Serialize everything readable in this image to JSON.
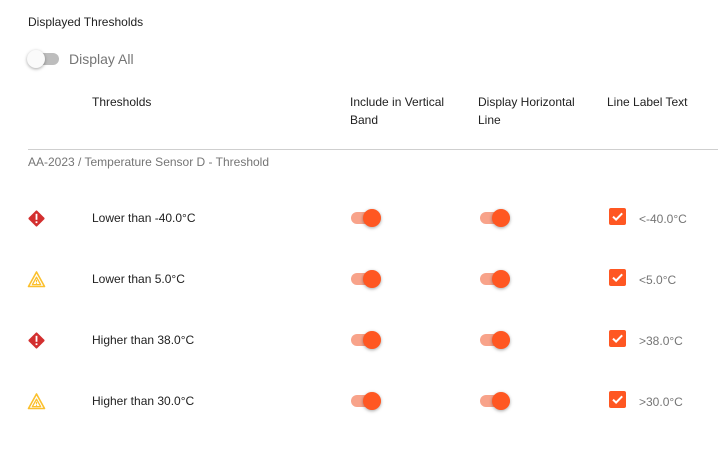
{
  "section_title": "Displayed Thresholds",
  "display_all": {
    "label": "Display All",
    "on": false
  },
  "columns": {
    "thresholds": "Thresholds",
    "vertical_band": "Include in Vertical Band",
    "horizontal_line": "Display Horizontal Line",
    "line_label": "Line Label Text"
  },
  "group_title": "AA-2023 / Temperature Sensor D - Threshold",
  "colors": {
    "accent": "#ff5722",
    "critical": "#d32f2f",
    "warning": "#fbc02d"
  },
  "rows": [
    {
      "severity": "critical",
      "icon": "critical-alert-icon",
      "threshold": "Lower than -40.0°C",
      "vertical_band": true,
      "horizontal_line": true,
      "label_enabled": true,
      "label_text": "<-40.0°C"
    },
    {
      "severity": "warning",
      "icon": "warning-triangle-icon",
      "threshold": "Lower than 5.0°C",
      "vertical_band": true,
      "horizontal_line": true,
      "label_enabled": true,
      "label_text": "<5.0°C"
    },
    {
      "severity": "critical",
      "icon": "critical-alert-icon",
      "threshold": "Higher than 38.0°C",
      "vertical_band": true,
      "horizontal_line": true,
      "label_enabled": true,
      "label_text": ">38.0°C"
    },
    {
      "severity": "warning",
      "icon": "warning-triangle-icon",
      "threshold": "Higher than 30.0°C",
      "vertical_band": true,
      "horizontal_line": true,
      "label_enabled": true,
      "label_text": ">30.0°C"
    }
  ]
}
